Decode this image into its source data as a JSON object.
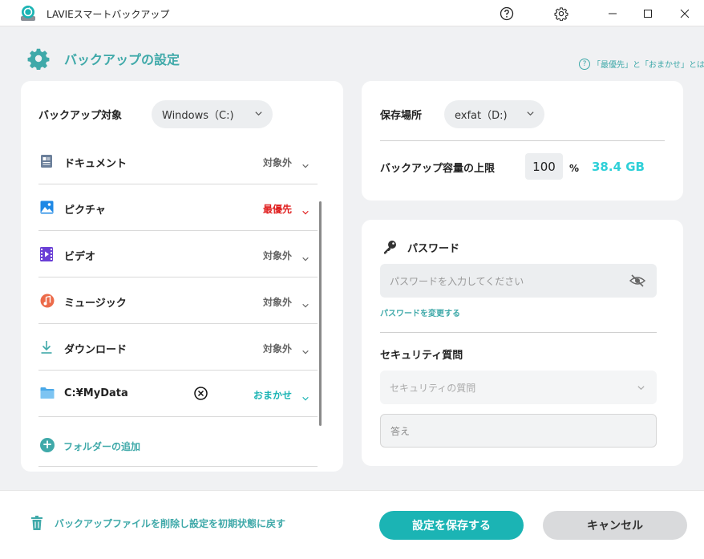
{
  "window": {
    "title": "LAVIEスマートバックアップ"
  },
  "header": {
    "title": "バックアップの設定",
    "help_link": "「最優先」と「おまかせ」とは？"
  },
  "backup_target": {
    "label": "バックアップ対象",
    "drive": "Windows（C:)",
    "items": [
      {
        "label": "ドキュメント",
        "status": "対象外",
        "icon": "document-icon",
        "status_color": "#666666"
      },
      {
        "label": "ピクチャ",
        "status": "最優先",
        "icon": "picture-icon",
        "status_color": "#e02020"
      },
      {
        "label": "ビデオ",
        "status": "対象外",
        "icon": "video-icon",
        "status_color": "#666666"
      },
      {
        "label": "ミュージック",
        "status": "対象外",
        "icon": "music-icon",
        "status_color": "#666666"
      },
      {
        "label": "ダウンロード",
        "status": "対象外",
        "icon": "download-icon",
        "status_color": "#666666"
      },
      {
        "label": "C:¥MyData",
        "status": "おまかせ",
        "icon": "folder-icon",
        "status_color": "#1bb4b4"
      }
    ],
    "add_folder": "フォルダーの追加"
  },
  "storage": {
    "location_label": "保存場所",
    "location_value": "exfat（D:)",
    "capacity_label": "バックアップ容量の上限",
    "capacity_percent": "100",
    "percent_sign": "%",
    "capacity_size": "38.4 GB"
  },
  "password": {
    "title": "パスワード",
    "placeholder": "パスワードを入力してください",
    "change_link": "パスワードを変更する",
    "security_title": "セキュリティ質問",
    "question_placeholder": "セキュリティの質問",
    "answer_placeholder": "答え"
  },
  "footer": {
    "reset_label": "バックアップファイルを削除し設定を初期状態に戻す",
    "save_label": "設定を保存する",
    "cancel_label": "キャンセル"
  },
  "colors": {
    "accent": "#1bb4b4",
    "accent_text": "#3fa9a9",
    "priority_red": "#e02020",
    "capacity_cyan": "#2fd0d8"
  }
}
